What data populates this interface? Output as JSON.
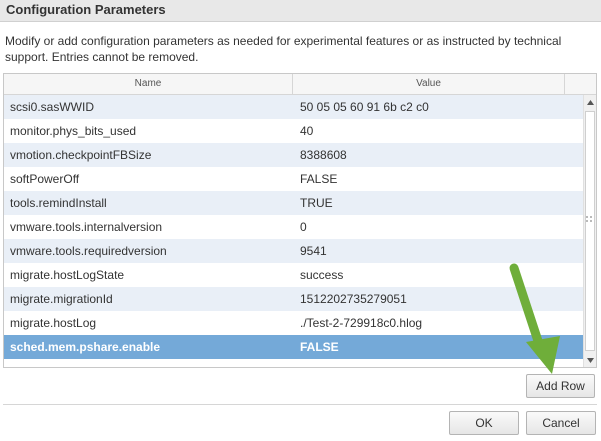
{
  "dialog": {
    "title": "Configuration Parameters",
    "description": "Modify or add configuration parameters as needed for experimental features or as instructed by technical support. Entries cannot be removed."
  },
  "grid": {
    "columns": {
      "name": "Name",
      "value": "Value"
    },
    "rows": [
      {
        "name": "scsi0.sasWWID",
        "value": "50 05 05 60 91 6b c2 c0"
      },
      {
        "name": "monitor.phys_bits_used",
        "value": "40"
      },
      {
        "name": "vmotion.checkpointFBSize",
        "value": "8388608"
      },
      {
        "name": "softPowerOff",
        "value": "FALSE"
      },
      {
        "name": "tools.remindInstall",
        "value": "TRUE"
      },
      {
        "name": "vmware.tools.internalversion",
        "value": "0"
      },
      {
        "name": "vmware.tools.requiredversion",
        "value": "9541"
      },
      {
        "name": "migrate.hostLogState",
        "value": "success"
      },
      {
        "name": "migrate.migrationId",
        "value": "1512202735279051"
      },
      {
        "name": "migrate.hostLog",
        "value": "./Test-2-729918c0.hlog"
      },
      {
        "name": "sched.mem.pshare.enable",
        "value": "FALSE"
      }
    ],
    "selected_row": 10
  },
  "buttons": {
    "add_row": "Add Row",
    "ok": "OK",
    "cancel": "Cancel"
  },
  "icons": {
    "scroll_up": "scroll-up-arrow-icon",
    "scroll_down": "scroll-down-arrow-icon",
    "annotation": "green-arrow-icon"
  },
  "colors": {
    "selected_row": "#74a9d8",
    "alt_row": "#e9eff7",
    "annotation_arrow": "#6fae3a"
  }
}
